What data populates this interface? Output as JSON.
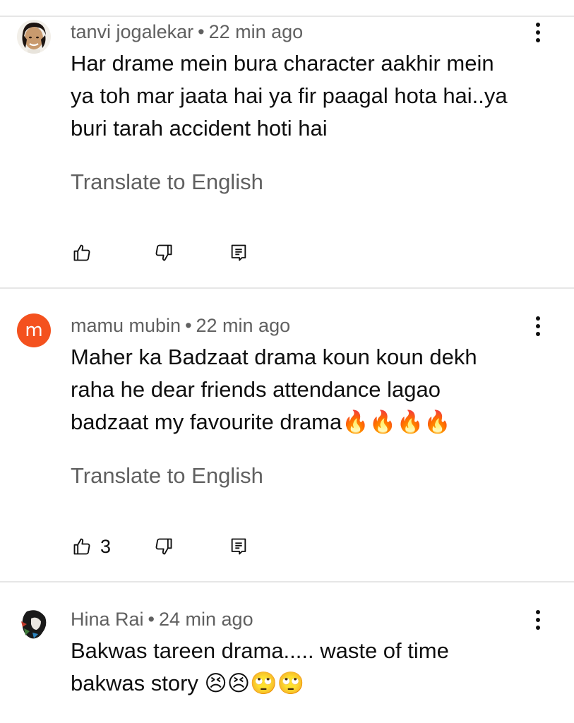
{
  "comments": [
    {
      "author": "tanvi jogalekar",
      "separator": "•",
      "time": "22 min ago",
      "text": "Har drame mein bura character aakhir mein\nya toh mar jaata hai ya fir paagal hota hai..ya\nburi tarah accident hoti hai",
      "translate_label": "Translate to English",
      "likes": "",
      "avatar_icon": "photo-avatar"
    },
    {
      "author": "mamu mubin",
      "separator": "•",
      "time": "22 min ago",
      "text": "Maher ka Badzaat drama koun koun dekh\nraha he dear friends attendance lagao\nbadzaat my favourite drama🔥🔥🔥🔥",
      "translate_label": "Translate to English",
      "likes": "3",
      "avatar_letter": "m",
      "avatar_color": "#f4511e"
    },
    {
      "author": "Hina Rai",
      "separator": "•",
      "time": "24 min ago",
      "text": "Bakwas tareen drama..... waste of time\nbakwas story 😣😣🙄🙄",
      "avatar_icon": "photo-avatar"
    }
  ],
  "icons": {
    "like": "thumb-up-icon",
    "dislike": "thumb-down-icon",
    "reply": "reply-comment-icon",
    "more": "more-vert-icon"
  }
}
